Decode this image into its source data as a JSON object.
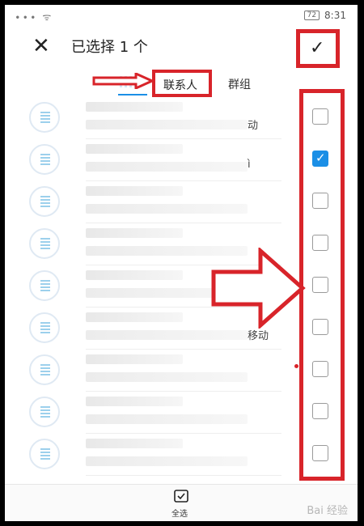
{
  "status_bar": {
    "left_icons": "∙∙∙ ᯤ",
    "battery": "72",
    "time": "8:31"
  },
  "header": {
    "close_icon": "close-icon",
    "close_glyph": "✕",
    "title": "已选择 1 个",
    "confirm_icon": "check-icon",
    "confirm_glyph": "✓"
  },
  "tabs": [
    {
      "label": "联系人"
    },
    {
      "label": "群组"
    }
  ],
  "contacts": [
    {
      "note": "动",
      "checked": false
    },
    {
      "note": "ì",
      "checked": true
    },
    {
      "note": "",
      "checked": false
    },
    {
      "note": "",
      "checked": false
    },
    {
      "note": "",
      "checked": false
    },
    {
      "note": "移动",
      "checked": false
    },
    {
      "note": "",
      "checked": false
    },
    {
      "note": "",
      "checked": false
    },
    {
      "note": "",
      "checked": false
    }
  ],
  "footer": {
    "select_all_label": "全选",
    "select_all_icon": "select-all-icon"
  },
  "watermark": "Bai 经验",
  "colors": {
    "accent": "#1b8fe6",
    "annotation": "#d8242a"
  }
}
